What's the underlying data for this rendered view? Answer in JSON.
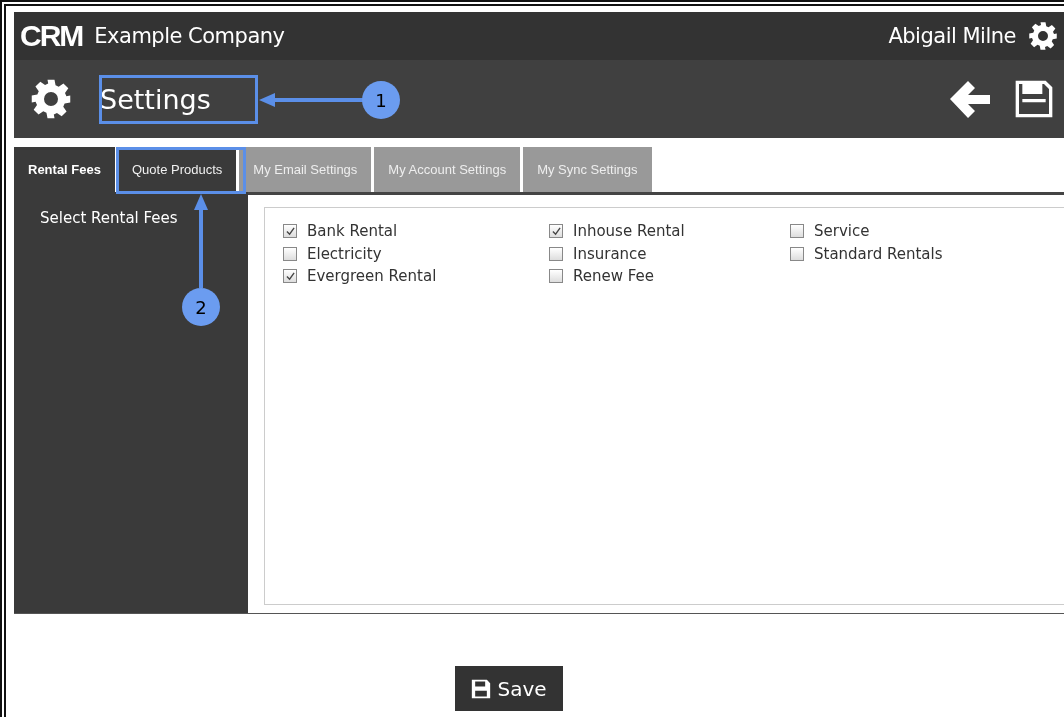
{
  "header": {
    "logo": "CRM",
    "company": "Example Company",
    "user": "Abigail Milne"
  },
  "page": {
    "title": "Settings"
  },
  "tabs": [
    {
      "label": "Rental Fees",
      "selected": true,
      "highlighted": false
    },
    {
      "label": "Quote Products",
      "selected": false,
      "highlighted": true
    },
    {
      "label": "My Email Settings",
      "selected": false,
      "highlighted": false
    },
    {
      "label": "My Account Settings",
      "selected": false,
      "highlighted": false
    },
    {
      "label": "My Sync Settings",
      "selected": false,
      "highlighted": false
    }
  ],
  "sidebar": {
    "heading": "Select Rental Fees"
  },
  "fee_columns": [
    [
      {
        "label": "Bank Rental",
        "checked": true
      },
      {
        "label": "Electricity",
        "checked": false
      },
      {
        "label": "Evergreen Rental",
        "checked": true
      }
    ],
    [
      {
        "label": "Inhouse Rental",
        "checked": true
      },
      {
        "label": "Insurance",
        "checked": false
      },
      {
        "label": "Renew Fee",
        "checked": false
      }
    ],
    [
      {
        "label": "Service",
        "checked": false
      },
      {
        "label": "Standard Rentals",
        "checked": false
      }
    ]
  ],
  "save_button": "Save",
  "callouts": [
    {
      "label": "1",
      "kind": "horizontal"
    },
    {
      "label": "2",
      "kind": "vertical"
    }
  ]
}
